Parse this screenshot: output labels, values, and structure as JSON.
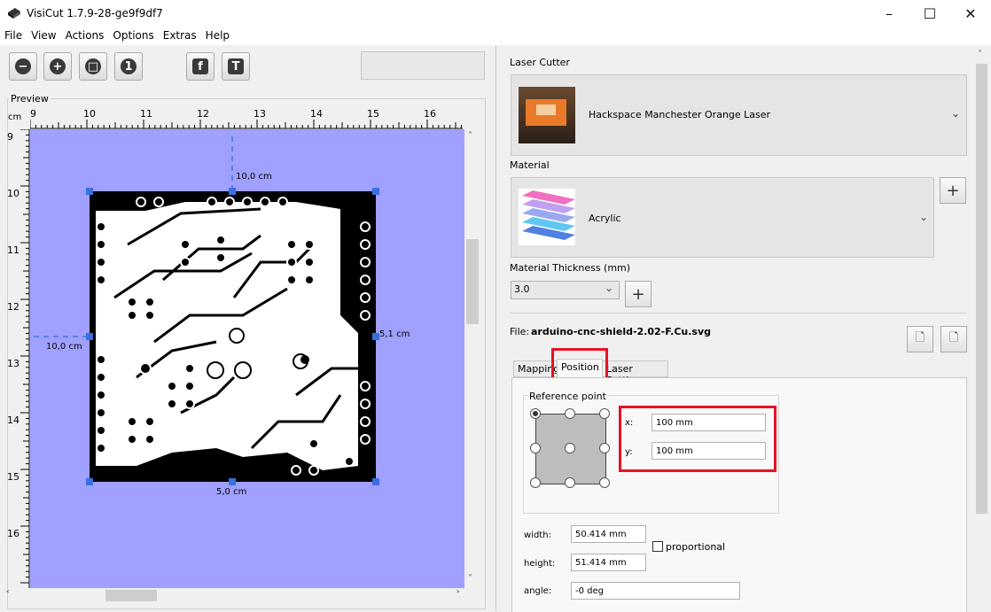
{
  "window": {
    "title": "VisiCut 1.7.9-28-ge9f9df7",
    "minimize_icon": "minimize-icon",
    "maximize_icon": "maximize-icon",
    "close_icon": "close-icon"
  },
  "menu": [
    "File",
    "View",
    "Actions",
    "Options",
    "Extras",
    "Help"
  ],
  "toolbar": {
    "icons": [
      "zoom-out-icon",
      "zoom-in-icon",
      "zoom-fit-icon",
      "zoom-reset-icon",
      "facebook-icon",
      "thingiverse-icon"
    ]
  },
  "preview": {
    "label": "Preview",
    "ruler_unit": "cm",
    "h_ticks": [
      "9",
      "10",
      "11",
      "12",
      "13",
      "14",
      "15",
      "16"
    ],
    "v_ticks": [
      "9",
      "10",
      "11",
      "12",
      "13",
      "14",
      "15",
      "16"
    ],
    "dim_top": "10,0 cm",
    "dim_left": "10,0 cm",
    "dim_right": "5,1 cm",
    "dim_bottom": "5,0 cm",
    "canvas_color": "#a0a0ff"
  },
  "laser_cutter": {
    "label": "Laser Cutter",
    "selected": "Hackspace Manchester Orange Laser"
  },
  "material": {
    "label": "Material",
    "selected": "Acrylic",
    "thickness_label": "Material Thickness (mm)",
    "thickness_value": "3.0"
  },
  "file": {
    "label": "File:",
    "name": "arduino-cnc-shield-2.02-F.Cu.svg"
  },
  "tabs": [
    "Mapping",
    "Position",
    "Laser Settings"
  ],
  "position": {
    "reference_point_label": "Reference point",
    "x_label": "x:",
    "x_value": "100 mm",
    "y_label": "y:",
    "y_value": "100 mm",
    "width_label": "width:",
    "width_value": "50.414 mm",
    "height_label": "height:",
    "height_value": "51.414 mm",
    "proportional_label": "proportional",
    "angle_label": "angle:",
    "angle_value": "-0 deg"
  },
  "colors": {
    "highlight": "#e81123",
    "canvas": "#a0a0ff",
    "selection_handle": "#3b6fe0"
  }
}
